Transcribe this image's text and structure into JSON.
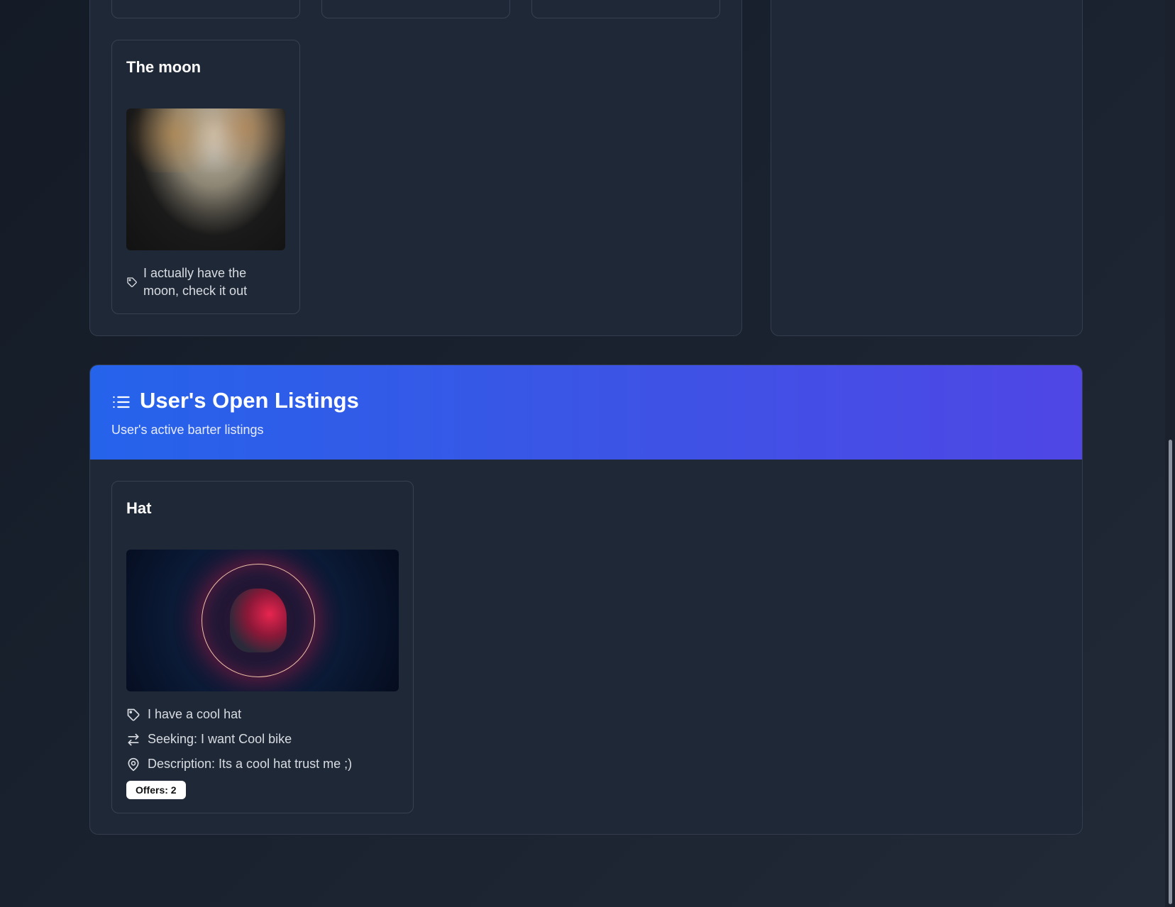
{
  "gallery": {
    "moon_card": {
      "title": "The moon",
      "caption": "I actually have the moon, check it out"
    }
  },
  "listings_section": {
    "title": "User's Open Listings",
    "subtitle": "User's active barter listings",
    "icon": "list-icon",
    "header_gradient": [
      "#2563eb",
      "#4f46e5"
    ]
  },
  "listings": [
    {
      "title": "Hat",
      "tag_text": "I have a cool hat",
      "seeking_text": "Seeking: I want Cool bike",
      "description_text": "Description: Its a cool hat trust me ;)",
      "offers_badge": "Offers: 2"
    }
  ],
  "colors": {
    "panel_bg": "#1f2836",
    "border": "#343d4d",
    "badge_bg": "#ffffff",
    "badge_text": "#111111"
  }
}
